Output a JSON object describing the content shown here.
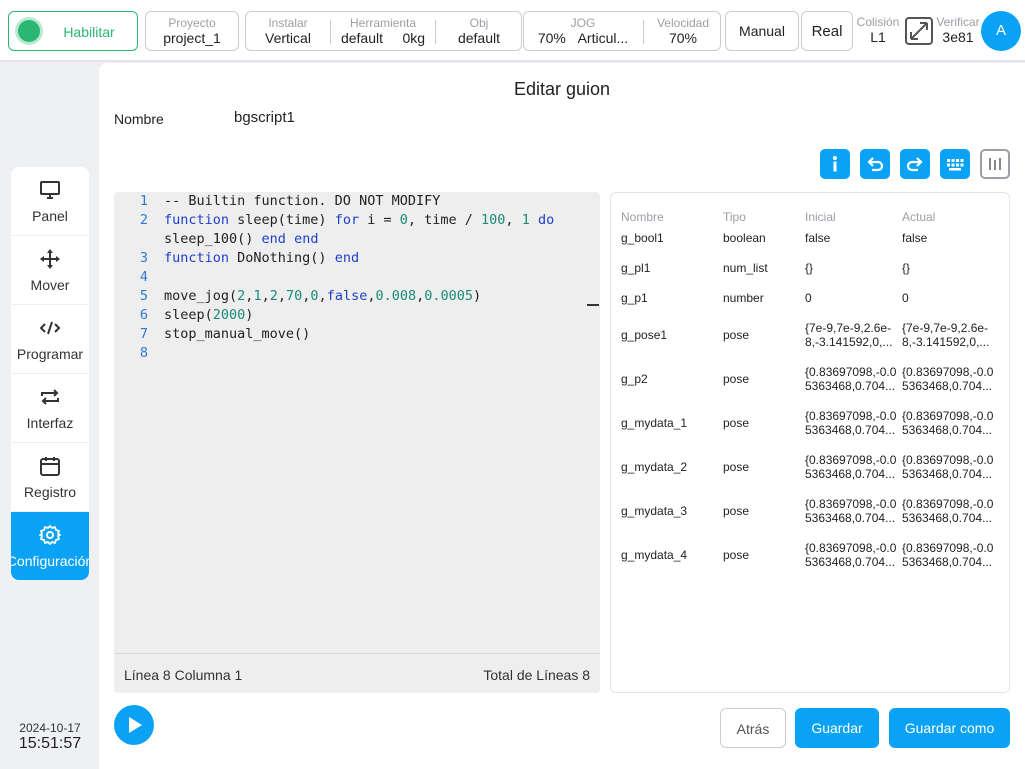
{
  "topbar": {
    "enable_label": "Habilitar",
    "project": {
      "label": "Proyecto",
      "value": "project_1"
    },
    "install": {
      "label": "Instalar",
      "value": "Vertical"
    },
    "tool": {
      "label": "Herramienta",
      "value": "default",
      "load": "0kg"
    },
    "obj": {
      "label": "Obj",
      "value": "default"
    },
    "jog": {
      "label": "JOG",
      "value": "70%",
      "mode": "Articul..."
    },
    "speed": {
      "label": "Velocidad",
      "value": "70%"
    },
    "manual_label": "Manual",
    "real_label": "Real",
    "collision": {
      "label": "Colisión",
      "value": "L1"
    },
    "verify": {
      "label": "Verificar",
      "value": "3e81"
    },
    "avatar": "A",
    "accent_color": "#0aa2f5",
    "enable_color": "#2bb673"
  },
  "sidebar": {
    "items": [
      {
        "label": "Panel",
        "icon": "monitor-icon"
      },
      {
        "label": "Mover",
        "icon": "move-arrows-icon"
      },
      {
        "label": "Programar",
        "icon": "code-icon"
      },
      {
        "label": "Interfaz",
        "icon": "swap-arrows-icon"
      },
      {
        "label": "Registro",
        "icon": "calendar-icon"
      },
      {
        "label": "Configuración",
        "icon": "gear-icon"
      }
    ],
    "active": "Configuración",
    "date": "2024-10-17",
    "time": "15:51:57"
  },
  "editor_page": {
    "title": "Editar guion",
    "name_label": "Nombre",
    "name_value": "bgscript1",
    "toolbar_icons": [
      "info-icon",
      "undo-icon",
      "redo-icon",
      "keyboard-icon",
      "columns-icon"
    ],
    "code_lines": [
      "-- Builtin function. DO NOT MODIFY",
      "function sleep(time) for i = 0, time / 100, 1 do sleep_100() end end",
      "function DoNothing() end",
      "",
      "move_jog(2,1,2,70,0,false,0.008,0.0005)",
      "sleep(2000)",
      "stop_manual_move()",
      ""
    ],
    "status_left": "Línea 8 Columna 1",
    "status_right": "Total de Líneas 8"
  },
  "variables": {
    "headers": [
      "Nombre",
      "Tipo",
      "Inicial",
      "Actual"
    ],
    "rows": [
      {
        "name": "g_bool1",
        "type": "boolean",
        "initial": "false",
        "current": "false"
      },
      {
        "name": "g_pl1",
        "type": "num_list",
        "initial": "{}",
        "current": "{}"
      },
      {
        "name": "g_p1",
        "type": "number",
        "initial": "0",
        "current": "0"
      },
      {
        "name": "g_pose1",
        "type": "pose",
        "initial": "{7e-9,7e-9,2.6e-",
        "initial2": "8,-3.141592,0,...",
        "current": "{7e-9,7e-9,2.6e-",
        "current2": "8,-3.141592,0,..."
      },
      {
        "name": "g_p2",
        "type": "pose",
        "initial": "{0.83697098,-0.0",
        "initial2": "5363468,0.704...",
        "current": "{0.83697098,-0.0",
        "current2": "5363468,0.704..."
      },
      {
        "name": "g_mydata_1",
        "type": "pose",
        "initial": "{0.83697098,-0.0",
        "initial2": "5363468,0.704...",
        "current": "{0.83697098,-0.0",
        "current2": "5363468,0.704..."
      },
      {
        "name": "g_mydata_2",
        "type": "pose",
        "initial": "{0.83697098,-0.0",
        "initial2": "5363468,0.704...",
        "current": "{0.83697098,-0.0",
        "current2": "5363468,0.704..."
      },
      {
        "name": "g_mydata_3",
        "type": "pose",
        "initial": "{0.83697098,-0.0",
        "initial2": "5363468,0.704...",
        "current": "{0.83697098,-0.0",
        "current2": "5363468,0.704..."
      },
      {
        "name": "g_mydata_4",
        "type": "pose",
        "initial": "{0.83697098,-0.0",
        "initial2": "5363468,0.704...",
        "current": "{0.83697098,-0.0",
        "current2": "5363468,0.704..."
      }
    ]
  },
  "actions": {
    "back_label": "Atrás",
    "save_label": "Guardar",
    "save_as_label": "Guardar como"
  }
}
